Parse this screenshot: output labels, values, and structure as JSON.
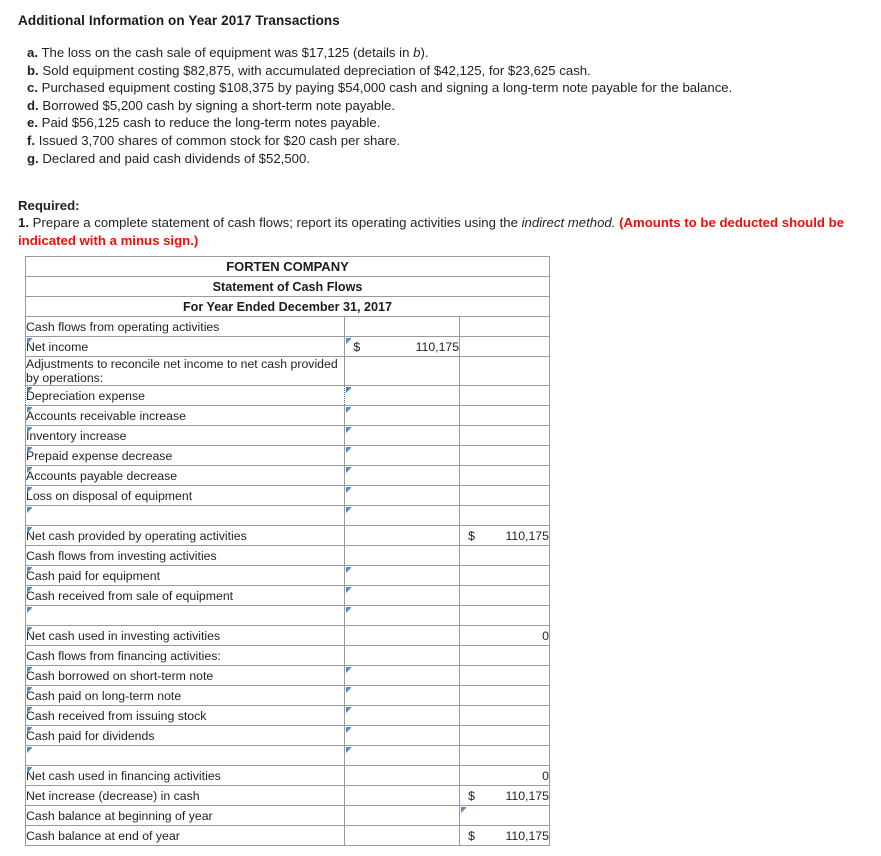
{
  "intro": {
    "title": "Additional Information on Year 2017 Transactions",
    "items": [
      {
        "letter": "a.",
        "text_before": "The loss on the cash sale of equipment was $17,125 (details in ",
        "italic": "b",
        "text_after": ")."
      },
      {
        "letter": "b.",
        "text_before": "Sold equipment costing $82,875, with accumulated depreciation of $42,125, for $23,625 cash.",
        "italic": "",
        "text_after": ""
      },
      {
        "letter": "c.",
        "text_before": "Purchased equipment costing $108,375 by paying $54,000 cash and signing a long-term note payable for the balance.",
        "italic": "",
        "text_after": ""
      },
      {
        "letter": "d.",
        "text_before": "Borrowed $5,200 cash by signing a short-term note payable.",
        "italic": "",
        "text_after": ""
      },
      {
        "letter": "e.",
        "text_before": "Paid $56,125 cash to reduce the long-term notes payable.",
        "italic": "",
        "text_after": ""
      },
      {
        "letter": "f.",
        "text_before": "Issued 3,700 shares of common stock for $20 cash per share.",
        "italic": "",
        "text_after": ""
      },
      {
        "letter": "g.",
        "text_before": "Declared and paid cash dividends of $52,500.",
        "italic": "",
        "text_after": ""
      }
    ]
  },
  "required": {
    "label": "Required:",
    "number": "1.",
    "text_1": "Prepare a complete statement of cash flows; report its operating activities using the ",
    "italic_1": "indirect method.",
    "red_text": "(Amounts to be deducted should be indicated with a minus sign.)"
  },
  "statement": {
    "company": "FORTEN COMPANY",
    "title": "Statement of Cash Flows",
    "period": "For Year Ended December 31, 2017",
    "rows": [
      {
        "label": "Cash flows from operating activities",
        "indent": 0,
        "label_style": "plain",
        "amt": {
          "style": "plain",
          "currency": "",
          "value": ""
        },
        "tot": {
          "style": "plain",
          "currency": "",
          "value": ""
        }
      },
      {
        "label": "Net income",
        "indent": 1,
        "label_style": "select",
        "amt": {
          "style": "input",
          "currency": "$",
          "value": "110,175"
        },
        "tot": {
          "style": "plain",
          "currency": "",
          "value": ""
        }
      },
      {
        "label": "Adjustments to reconcile net income to net cash provided by operations:",
        "indent": 1,
        "label_style": "plain",
        "amt": {
          "style": "plain",
          "currency": "",
          "value": ""
        },
        "tot": {
          "style": "plain",
          "currency": "",
          "value": ""
        }
      },
      {
        "label": "Depreciation expense",
        "indent": 2,
        "label_style": "select-dotted",
        "amt": {
          "style": "input-dotted",
          "currency": "",
          "value": ""
        },
        "tot": {
          "style": "plain",
          "currency": "",
          "value": ""
        }
      },
      {
        "label": "Accounts receivable increase",
        "indent": 2,
        "label_style": "select",
        "amt": {
          "style": "input",
          "currency": "",
          "value": ""
        },
        "tot": {
          "style": "plain",
          "currency": "",
          "value": ""
        }
      },
      {
        "label": "Inventory increase",
        "indent": 2,
        "label_style": "select",
        "amt": {
          "style": "input",
          "currency": "",
          "value": ""
        },
        "tot": {
          "style": "plain",
          "currency": "",
          "value": ""
        }
      },
      {
        "label": "Prepaid expense decrease",
        "indent": 2,
        "label_style": "select",
        "amt": {
          "style": "input",
          "currency": "",
          "value": ""
        },
        "tot": {
          "style": "plain",
          "currency": "",
          "value": ""
        }
      },
      {
        "label": "Accounts payable decrease",
        "indent": 2,
        "label_style": "select",
        "amt": {
          "style": "input",
          "currency": "",
          "value": ""
        },
        "tot": {
          "style": "plain",
          "currency": "",
          "value": ""
        }
      },
      {
        "label": "Loss on disposal of equipment",
        "indent": 2,
        "label_style": "select",
        "amt": {
          "style": "input",
          "currency": "",
          "value": ""
        },
        "tot": {
          "style": "plain",
          "currency": "",
          "value": ""
        }
      },
      {
        "label": "",
        "indent": 2,
        "label_style": "select",
        "amt": {
          "style": "input-underline",
          "currency": "",
          "value": ""
        },
        "tot": {
          "style": "plain",
          "currency": "",
          "value": ""
        }
      },
      {
        "label": "Net cash provided by operating activities",
        "indent": 1,
        "label_style": "select",
        "amt": {
          "style": "plain",
          "currency": "",
          "value": ""
        },
        "tot": {
          "style": "plain",
          "currency": "$",
          "value": "110,175"
        }
      },
      {
        "label": "Cash flows from investing activities",
        "indent": 0,
        "label_style": "plain",
        "amt": {
          "style": "none",
          "currency": "",
          "value": ""
        },
        "tot": {
          "style": "plain",
          "currency": "",
          "value": ""
        }
      },
      {
        "label": "Cash paid for equipment",
        "indent": 3,
        "label_style": "select",
        "amt": {
          "style": "input",
          "currency": "",
          "value": ""
        },
        "tot": {
          "style": "plain",
          "currency": "",
          "value": ""
        }
      },
      {
        "label": "Cash received from sale of equipment",
        "indent": 3,
        "label_style": "select",
        "amt": {
          "style": "input",
          "currency": "",
          "value": ""
        },
        "tot": {
          "style": "plain",
          "currency": "",
          "value": ""
        }
      },
      {
        "label": "",
        "indent": 3,
        "label_style": "select",
        "amt": {
          "style": "input-underline",
          "currency": "",
          "value": ""
        },
        "tot": {
          "style": "plain",
          "currency": "",
          "value": ""
        }
      },
      {
        "label": "Net cash used in investing activities",
        "indent": 1,
        "label_style": "select",
        "amt": {
          "style": "plain",
          "currency": "",
          "value": ""
        },
        "tot": {
          "style": "plain",
          "currency": "",
          "value": "0"
        }
      },
      {
        "label": "Cash flows from financing activities:",
        "indent": 0,
        "label_style": "plain",
        "amt": {
          "style": "none",
          "currency": "",
          "value": ""
        },
        "tot": {
          "style": "plain",
          "currency": "",
          "value": ""
        }
      },
      {
        "label": "Cash borrowed on short-term note",
        "indent": 3,
        "label_style": "select",
        "amt": {
          "style": "input",
          "currency": "",
          "value": ""
        },
        "tot": {
          "style": "plain",
          "currency": "",
          "value": ""
        }
      },
      {
        "label": "Cash paid on long-term note",
        "indent": 3,
        "label_style": "select",
        "amt": {
          "style": "input",
          "currency": "",
          "value": ""
        },
        "tot": {
          "style": "plain",
          "currency": "",
          "value": ""
        }
      },
      {
        "label": "Cash received from issuing stock",
        "indent": 3,
        "label_style": "select",
        "amt": {
          "style": "input",
          "currency": "",
          "value": ""
        },
        "tot": {
          "style": "plain",
          "currency": "",
          "value": ""
        }
      },
      {
        "label": "Cash paid for dividends",
        "indent": 3,
        "label_style": "select",
        "amt": {
          "style": "input",
          "currency": "",
          "value": ""
        },
        "tot": {
          "style": "plain",
          "currency": "",
          "value": ""
        }
      },
      {
        "label": "",
        "indent": 3,
        "label_style": "select",
        "amt": {
          "style": "input-underline",
          "currency": "",
          "value": ""
        },
        "tot": {
          "style": "plain",
          "currency": "",
          "value": ""
        }
      },
      {
        "label": "Net cash used in financing activities",
        "indent": 1,
        "label_style": "select",
        "amt": {
          "style": "plain",
          "currency": "",
          "value": ""
        },
        "tot": {
          "style": "plain",
          "currency": "",
          "value": "0"
        }
      },
      {
        "label": "Net increase (decrease) in cash",
        "indent": 0,
        "label_style": "plain",
        "amt": {
          "style": "none",
          "currency": "",
          "value": ""
        },
        "tot": {
          "style": "plain",
          "currency": "$",
          "value": "110,175"
        }
      },
      {
        "label": "Cash balance at beginning of year",
        "indent": 0,
        "label_style": "plain",
        "amt": {
          "style": "none",
          "currency": "",
          "value": ""
        },
        "tot": {
          "style": "input",
          "currency": "",
          "value": ""
        }
      },
      {
        "label": "Cash balance at end of year",
        "indent": 0,
        "label_style": "plain",
        "amt": {
          "style": "none",
          "currency": "",
          "value": ""
        },
        "tot": {
          "style": "plain-uline",
          "currency": "$",
          "value": "110,175"
        }
      }
    ]
  },
  "colors": {
    "header_blue": "#7ba7dc",
    "input_border": "#5b8cc0",
    "alert_red": "#e8120b"
  }
}
